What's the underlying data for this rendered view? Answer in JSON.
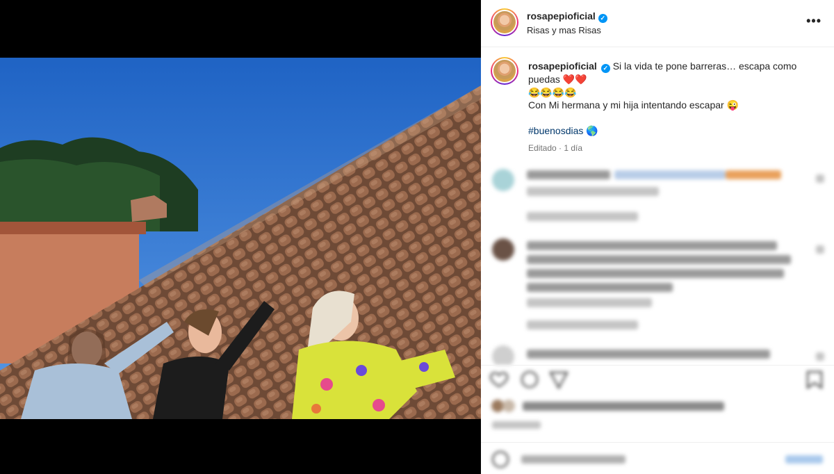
{
  "post": {
    "username": "rosapepioficial",
    "verified_mark": "✓",
    "location": "Risas y mas Risas",
    "more_label": "•••"
  },
  "caption": {
    "username": "rosapepioficial",
    "line1": "Si la vida te pone barreras… escapa como puedas ❤️❤️",
    "line2": "😂😂😂😂",
    "line3": "Con Mi hermana y mi hija intentando escapar 😜",
    "hashtag": "#buenosdias 🌎",
    "meta": "Editado · 1 día"
  },
  "icons": {
    "more": "more-options-icon",
    "verified": "verified-badge-icon",
    "like": "heart-icon",
    "comment": "comment-icon",
    "share": "share-icon",
    "save": "bookmark-icon",
    "emoji": "emoji-icon"
  },
  "colors": {
    "verified": "#0095f6",
    "hashtag": "#00376b",
    "sky": "#2f78d6",
    "roof": "#8a5a3e"
  }
}
